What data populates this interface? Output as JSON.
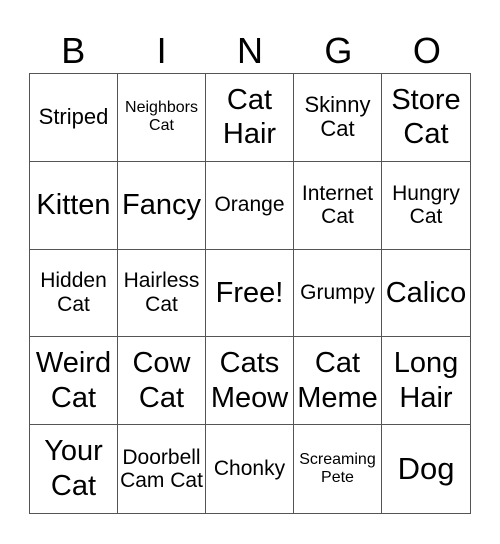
{
  "header": [
    "B",
    "I",
    "N",
    "G",
    "O"
  ],
  "cells": [
    {
      "text": "Striped",
      "size": "s3"
    },
    {
      "text": "Neighbors Cat",
      "size": "s1"
    },
    {
      "text": "Cat Hair",
      "size": "s4"
    },
    {
      "text": "Skinny Cat",
      "size": "s3"
    },
    {
      "text": "Store Cat",
      "size": "s4"
    },
    {
      "text": "Kitten",
      "size": "s4"
    },
    {
      "text": "Fancy",
      "size": "s4"
    },
    {
      "text": "Orange",
      "size": "s2"
    },
    {
      "text": "Internet Cat",
      "size": "s2"
    },
    {
      "text": "Hungry Cat",
      "size": "s2"
    },
    {
      "text": "Hidden Cat",
      "size": "s2"
    },
    {
      "text": "Hairless Cat",
      "size": "s2"
    },
    {
      "text": "Free!",
      "size": "s4"
    },
    {
      "text": "Grumpy",
      "size": "s2"
    },
    {
      "text": "Calico",
      "size": "s4"
    },
    {
      "text": "Weird Cat",
      "size": "s4"
    },
    {
      "text": "Cow Cat",
      "size": "s4"
    },
    {
      "text": "Cats Meow",
      "size": "s4"
    },
    {
      "text": "Cat Meme",
      "size": "s4"
    },
    {
      "text": "Long Hair",
      "size": "s4"
    },
    {
      "text": "Your Cat",
      "size": "s4"
    },
    {
      "text": "Doorbell Cam Cat",
      "size": "s2"
    },
    {
      "text": "Chonky",
      "size": "s2"
    },
    {
      "text": "Screaming Pete",
      "size": "s1"
    },
    {
      "text": "Dog",
      "size": "s5"
    }
  ]
}
